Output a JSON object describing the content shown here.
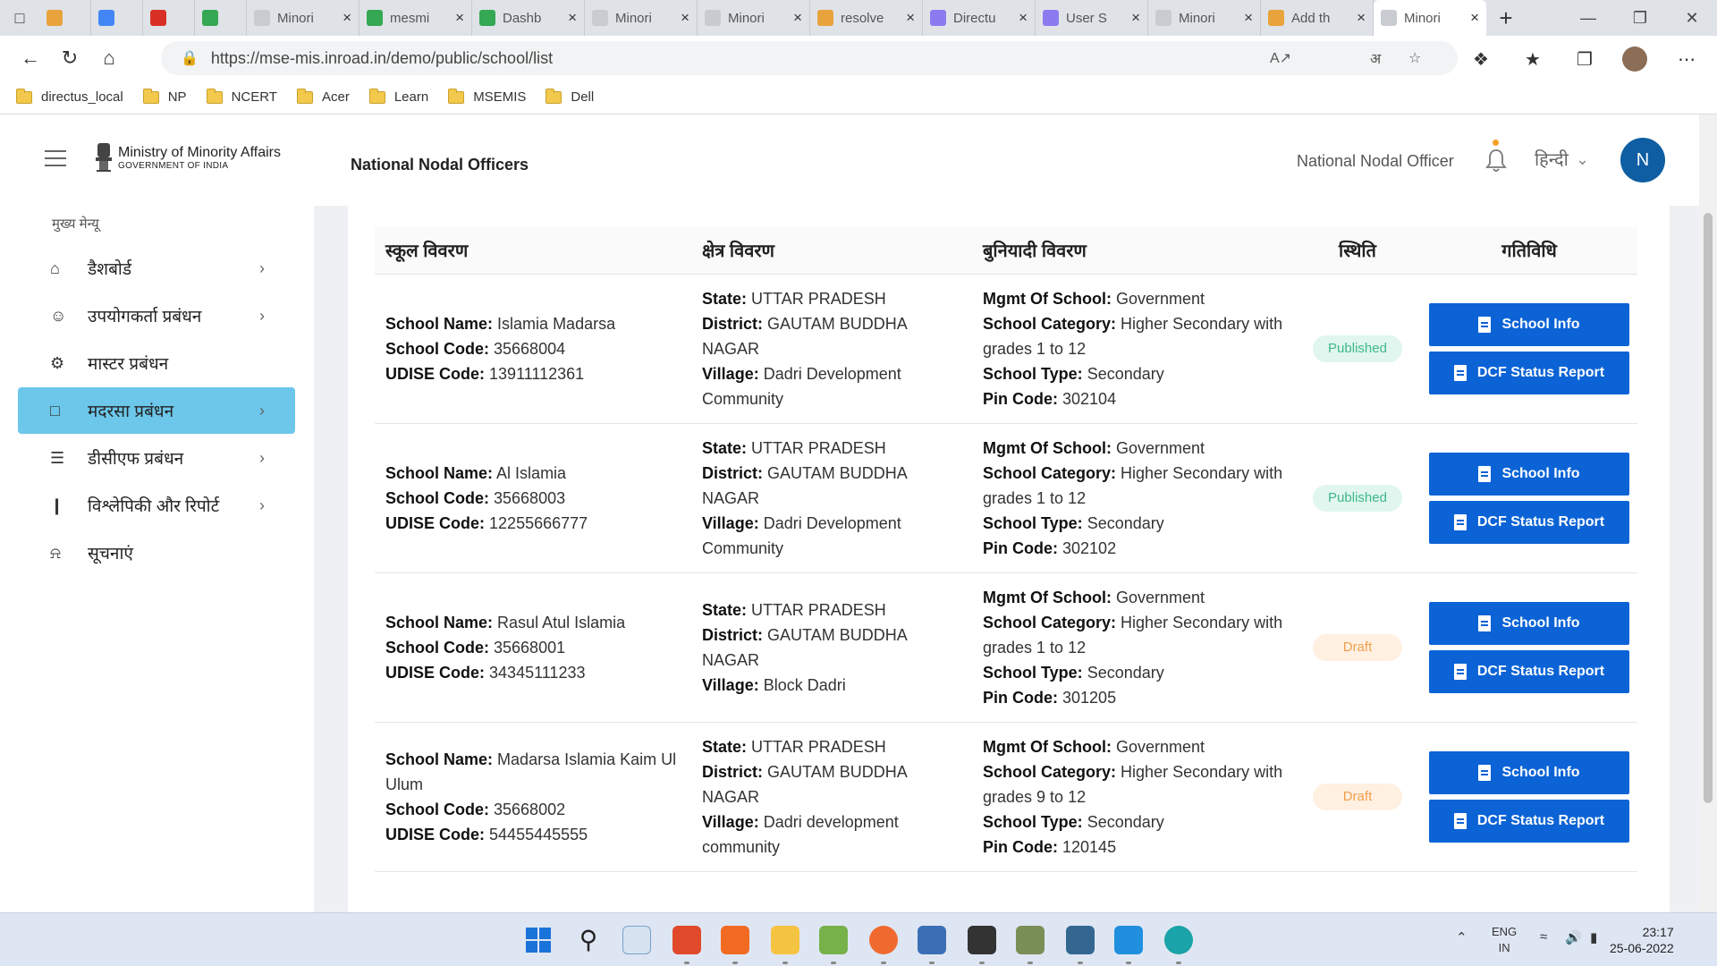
{
  "browser": {
    "tabs": [
      {
        "title": "",
        "color": "#e8a33c"
      },
      {
        "title": "",
        "color": "#4285f4"
      },
      {
        "title": "",
        "color": "#d93025"
      },
      {
        "title": "",
        "color": "#34a853"
      },
      {
        "title": "Minori",
        "color": "#c8ccd1"
      },
      {
        "title": "mesmi",
        "color": "#34a853"
      },
      {
        "title": "Dashb",
        "color": "#34a853"
      },
      {
        "title": "Minori",
        "color": "#c8ccd1"
      },
      {
        "title": "Minori",
        "color": "#c8ccd1"
      },
      {
        "title": "resolve",
        "color": "#e8a33c"
      },
      {
        "title": "Directu",
        "color": "#8a7cf0"
      },
      {
        "title": "User S",
        "color": "#8a7cf0"
      },
      {
        "title": "Minori",
        "color": "#c8ccd1"
      },
      {
        "title": "Add th",
        "color": "#e8a33c"
      },
      {
        "title": "Minori",
        "color": "#c8ccd1"
      }
    ],
    "url": "https://mse-mis.inroad.in/demo/public/school/list",
    "bookmarks": [
      "directus_local",
      "NP",
      "NCERT",
      "Acer",
      "Learn",
      "MSEMIS",
      "Dell"
    ]
  },
  "header": {
    "org_line1": "Ministry of Minority Affairs",
    "org_line2": "GOVERNMENT OF INDIA",
    "page_title": "National Nodal Officers",
    "role": "National Nodal Officer",
    "language": "हिन्दी",
    "avatar_initial": "N"
  },
  "sidebar": {
    "heading": "मुख्य मेन्यू",
    "items": [
      {
        "label": "डैशबोर्ड",
        "icon": "home-icon",
        "chevron": true
      },
      {
        "label": "उपयोगकर्ता प्रबंधन",
        "icon": "users-icon",
        "chevron": true
      },
      {
        "label": "मास्टर प्रबंधन",
        "icon": "gear-icon",
        "chevron": false
      },
      {
        "label": "मदरसा प्रबंधन",
        "icon": "folder-icon",
        "chevron": true,
        "active": true
      },
      {
        "label": "डीसीएफ प्रबंधन",
        "icon": "server-icon",
        "chevron": true
      },
      {
        "label": "विश्लेपिकी और रिपोर्ट",
        "icon": "bar-chart-icon",
        "chevron": true
      },
      {
        "label": "सूचनाएं",
        "icon": "bell-icon",
        "chevron": false
      }
    ]
  },
  "table": {
    "headers": [
      "स्कूल विवरण",
      "क्षेत्र विवरण",
      "बुनियादी विवरण",
      "स्थिति",
      "गतिविधि"
    ],
    "labels": {
      "school_name": "School Name:",
      "school_code": "School Code:",
      "udise_code": "UDISE Code:",
      "state": "State:",
      "district": "District:",
      "village": "Village:",
      "mgmt": "Mgmt Of School:",
      "category": "School Category:",
      "type": "School Type:",
      "pin": "Pin Code:"
    },
    "buttons": {
      "info": "School Info",
      "dcf": "DCF Status Report"
    },
    "rows": [
      {
        "school_name": "Islamia Madarsa",
        "school_code": "35668004",
        "udise_code": "13911112361",
        "state": "UTTAR PRADESH",
        "district": "GAUTAM BUDDHA NAGAR",
        "village": "Dadri Development Community",
        "mgmt": "Government",
        "category": "Higher Secondary with grades 1 to 12",
        "type": "Secondary",
        "pin": "302104",
        "status": "Published"
      },
      {
        "school_name": "Al Islamia",
        "school_code": "35668003",
        "udise_code": "12255666777",
        "state": "UTTAR PRADESH",
        "district": "GAUTAM BUDDHA NAGAR",
        "village": "Dadri Development Community",
        "mgmt": "Government",
        "category": "Higher Secondary with grades 1 to 12",
        "type": "Secondary",
        "pin": "302102",
        "status": "Published"
      },
      {
        "school_name": "Rasul Atul Islamia",
        "school_code": "35668001",
        "udise_code": "34345111233",
        "state": "UTTAR PRADESH",
        "district": "GAUTAM BUDDHA NAGAR",
        "village": "Block Dadri",
        "mgmt": "Government",
        "category": "Higher Secondary with grades 1 to 12",
        "type": "Secondary",
        "pin": "301205",
        "status": "Draft"
      },
      {
        "school_name": "Madarsa Islamia Kaim Ul Ulum",
        "school_code": "35668002",
        "udise_code": "54455445555",
        "state": "UTTAR PRADESH",
        "district": "GAUTAM BUDDHA NAGAR",
        "village": "Dadri development community",
        "mgmt": "Government",
        "category": "Higher Secondary with grades 9 to 12",
        "type": "Secondary",
        "pin": "120145",
        "status": "Draft"
      }
    ]
  },
  "taskbar": {
    "lang1": "ENG",
    "lang2": "IN",
    "time": "23:17",
    "date": "25-06-2022"
  },
  "colors": {
    "primary_button": "#0b63d6",
    "active_menu": "#6cc7ea",
    "published": "#3fb88a",
    "draft": "#f0a04b",
    "avatar": "#0f5ea3"
  }
}
